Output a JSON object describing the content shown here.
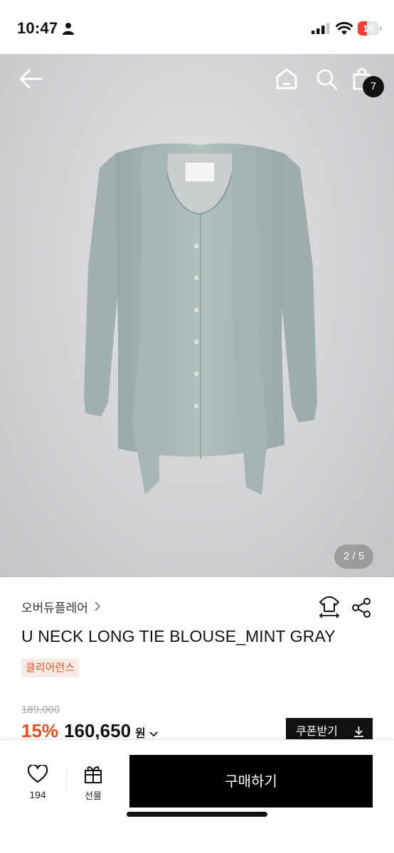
{
  "status_bar": {
    "time": "10:47",
    "battery": "16"
  },
  "nav": {
    "cart_count": "7"
  },
  "gallery": {
    "counter": "2 / 5"
  },
  "product": {
    "brand": "오버듀플레어",
    "title": "U NECK LONG TIE BLOUSE_MINT GRAY",
    "tag": "클리어런스",
    "original_price": "189,000",
    "discount": "15%",
    "price": "160,650",
    "currency": "원"
  },
  "coupon": {
    "label": "쿠폰받기"
  },
  "bottom": {
    "like_count": "194",
    "gift_label": "선물",
    "buy_label": "구매하기"
  },
  "icons": [
    "person-icon",
    "signal-icon",
    "wifi-icon",
    "back-arrow-icon",
    "home-icon",
    "search-icon",
    "cart-icon",
    "chevron-right-icon",
    "size-hanger-icon",
    "share-icon",
    "chevron-down-icon",
    "download-icon",
    "heart-icon",
    "gift-icon"
  ]
}
